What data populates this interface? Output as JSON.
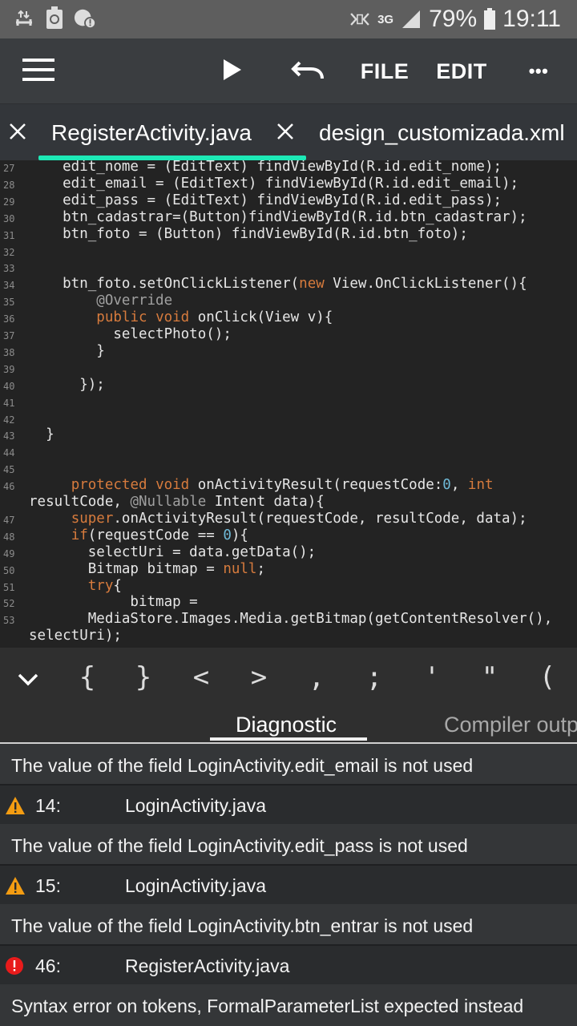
{
  "status_bar": {
    "left_icons": [
      "usb-transfer-icon",
      "recycle-icon",
      "notification-alert-icon"
    ],
    "right_icons": [
      "nfc-icon",
      "signal-icon",
      "battery-icon"
    ],
    "network": "3G",
    "battery": "79%",
    "time": "19:11"
  },
  "toolbar": {
    "file_label": "FILE",
    "edit_label": "EDIT",
    "more_label": "•••"
  },
  "tabs": [
    {
      "label": "RegisterActivity.java",
      "active": true
    },
    {
      "label": "design_customizada.xml",
      "active": false
    }
  ],
  "code": {
    "lines": [
      {
        "n": "27",
        "text": "    edit_nome = (EditText) findViewById(R.id.edit_nome);"
      },
      {
        "n": "28",
        "text": "    edit_email = (EditText) findViewById(R.id.edit_email);"
      },
      {
        "n": "29",
        "text": "    edit_pass = (EditText) findViewById(R.id.edit_pass);"
      },
      {
        "n": "30",
        "text": "    btn_cadastrar=(Button)findViewById(R.id.btn_cadastrar);"
      },
      {
        "n": "31",
        "text": "    btn_foto = (Button) findViewById(R.id.btn_foto);"
      },
      {
        "n": "32",
        "text": ""
      },
      {
        "n": "33",
        "text": ""
      },
      {
        "n": "34",
        "text": "    btn_foto.setOnClickListener(new View.OnClickListener(){"
      },
      {
        "n": "35",
        "text": "        @Override"
      },
      {
        "n": "36",
        "text": "        public void onClick(View v){"
      },
      {
        "n": "37",
        "text": "          selectPhoto();"
      },
      {
        "n": "38",
        "text": "        }"
      },
      {
        "n": "39",
        "text": ""
      },
      {
        "n": "40",
        "text": "      });"
      },
      {
        "n": "41",
        "text": ""
      },
      {
        "n": "42",
        "text": ""
      },
      {
        "n": "43",
        "text": "  }"
      },
      {
        "n": "44",
        "text": ""
      },
      {
        "n": "45",
        "text": ""
      },
      {
        "n": "46",
        "text": "     protected void onActivityResult(requestCode:0, int"
      },
      {
        "n": "",
        "text": "resultCode, @Nullable Intent data){"
      },
      {
        "n": "47",
        "text": "     super.onActivityResult(requestCode, resultCode, data);"
      },
      {
        "n": "48",
        "text": "     if(requestCode == 0){"
      },
      {
        "n": "49",
        "text": "       selectUri = data.getData();"
      },
      {
        "n": "50",
        "text": "       Bitmap bitmap = null;"
      },
      {
        "n": "51",
        "text": "       try{"
      },
      {
        "n": "52",
        "text": "            bitmap ="
      },
      {
        "n": "53",
        "text": "       MediaStore.Images.Media.getBitmap(getContentResolver(),"
      },
      {
        "n": "",
        "text": "selectUri);"
      }
    ]
  },
  "symbols": [
    "{",
    "}",
    "<",
    ">",
    ",",
    ";",
    "'",
    "\"",
    "("
  ],
  "panel_tabs": {
    "diagnostic": "Diagnostic",
    "compiler_output": "Compiler outp"
  },
  "diagnostics": {
    "first_message": "The value of the field LoginActivity.edit_email is not used",
    "items": [
      {
        "severity": "warning",
        "line": "14:",
        "file": "LoginActivity.java",
        "message": "The value of the field LoginActivity.edit_pass is not used"
      },
      {
        "severity": "warning",
        "line": "15:",
        "file": "LoginActivity.java",
        "message": "The value of the field LoginActivity.btn_entrar is not used"
      },
      {
        "severity": "error",
        "line": "46:",
        "file": "RegisterActivity.java",
        "message": "Syntax error on tokens, FormalParameterList expected instead"
      }
    ]
  },
  "colors": {
    "accent": "#1de9b6",
    "warning": "#f39c12",
    "error": "#e81b1b",
    "keyword": "#d77b3d"
  }
}
